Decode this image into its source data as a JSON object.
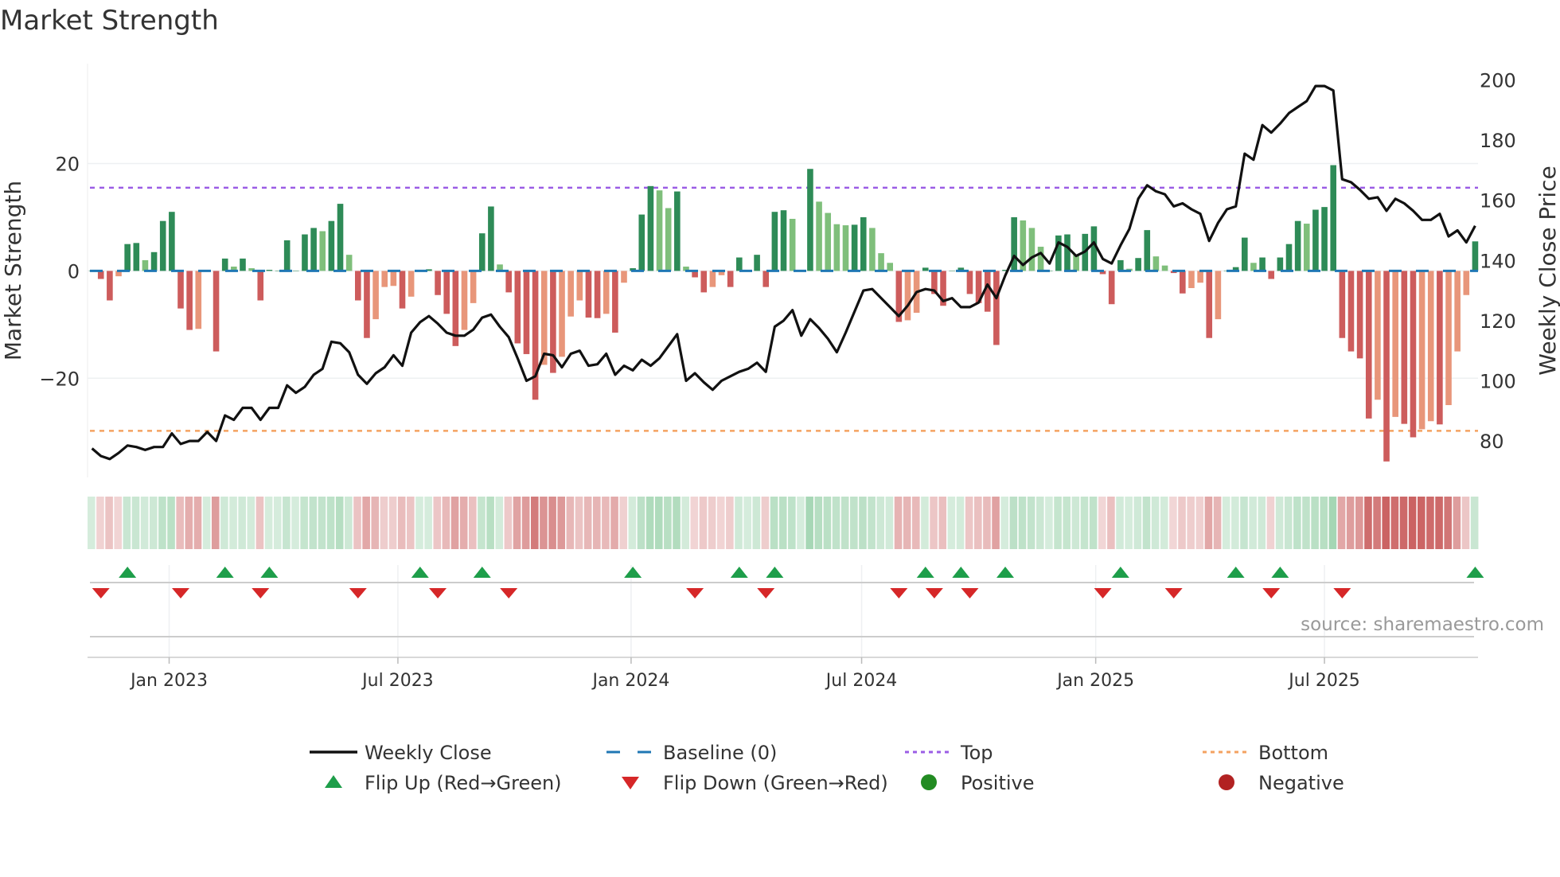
{
  "chart_data": {
    "type": "bar",
    "title": "Market Strength",
    "ylabel": "Market Strength",
    "y2label": "Weekly Close Price",
    "ylim": [
      -38,
      40
    ],
    "y2lim": [
      70,
      206
    ],
    "yticks": [
      20,
      0,
      -20
    ],
    "ytick_labels": [
      "20",
      "0",
      "−20"
    ],
    "y2ticks": [
      200,
      180,
      160,
      140,
      120,
      100,
      80
    ],
    "y2tick_labels": [
      "200",
      "180",
      "160",
      "140",
      "120",
      "100",
      "80"
    ],
    "top_level": 15.5,
    "bottom_level": -29.8,
    "baseline": 0,
    "xticks": [
      {
        "week": 8.7,
        "label": "Jan 2023"
      },
      {
        "week": 34.5,
        "label": "Jul 2023"
      },
      {
        "week": 60.8,
        "label": "Jan 2024"
      },
      {
        "week": 86.8,
        "label": "Jul 2024"
      },
      {
        "week": 113.2,
        "label": "Jan 2025"
      },
      {
        "week": 139.0,
        "label": "Jul 2025"
      }
    ],
    "strength": [
      0,
      -1.5,
      -5.5,
      -1,
      5,
      5.2,
      2,
      3.5,
      9.3,
      11,
      -7,
      -11,
      -10.8,
      0,
      -15,
      2.3,
      0.8,
      2.3,
      0.5,
      -5.5,
      0.2,
      0,
      5.7,
      0,
      6.8,
      8,
      7.4,
      9.3,
      12.5,
      3,
      -5.5,
      -12.5,
      -9,
      -3,
      -2.8,
      -7,
      -4.8,
      0,
      0.3,
      -4.5,
      -8,
      -14,
      -11,
      -6,
      7,
      12,
      1.2,
      -4,
      -13.5,
      -15.5,
      -24,
      -17.5,
      -19,
      -16,
      -8.5,
      -5.5,
      -8.7,
      -8.8,
      -8,
      -11.5,
      -2.2,
      0.5,
      10.5,
      15.8,
      15,
      11.7,
      14.8,
      0.8,
      -1.2,
      -4,
      -3,
      -0.8,
      -3,
      2.5,
      0.2,
      3,
      -3,
      11,
      11.3,
      9.7,
      0,
      19,
      12.9,
      10.8,
      8.7,
      8.5,
      8.6,
      10,
      8,
      3.3,
      1.5,
      -9.5,
      -9.2,
      -7.8,
      0.6,
      -4.3,
      -6.5,
      0,
      0.6,
      -4.3,
      -6,
      -7.6,
      -13.8,
      0.2,
      10,
      9.4,
      8,
      4.5,
      0,
      6.6,
      6.8,
      3,
      6.9,
      8.3,
      -0.6,
      -6.2,
      2,
      0.4,
      2.4,
      7.6,
      2.7,
      1,
      -0.4,
      -4.2,
      -3.2,
      -2.2,
      -12.5,
      -9,
      0,
      0.7,
      6.2,
      1.5,
      2.5,
      -1.5,
      2.5,
      5,
      9.3,
      8.8,
      11.4,
      11.9,
      19.7,
      -12.5,
      -15,
      -16.3,
      -27.5,
      -24,
      -35.5,
      -27.2,
      -28.5,
      -31,
      -29.5,
      -28,
      -28.6,
      -25,
      -15,
      -4.5,
      5.5
    ],
    "weekly_close": [
      77.5,
      75,
      74,
      76,
      78.5,
      78,
      77,
      78,
      78,
      82.5,
      79,
      80,
      80,
      83,
      80,
      88.5,
      87,
      91,
      91,
      87,
      91,
      91,
      98.5,
      96,
      98,
      102,
      104,
      113,
      112.5,
      109.5,
      102,
      99,
      102.5,
      104.5,
      108.5,
      105,
      116,
      119.5,
      121.5,
      119,
      116,
      115,
      115,
      117,
      121,
      122,
      118,
      114.5,
      107.5,
      100,
      101.5,
      109,
      108.5,
      104.5,
      109,
      110,
      105,
      105.5,
      109,
      102,
      105,
      103.5,
      107,
      105,
      107.5,
      111.5,
      115.5,
      100,
      102.5,
      99.5,
      97,
      100,
      101.5,
      103,
      104,
      106,
      103,
      118,
      120,
      123.5,
      115,
      120.5,
      117.5,
      114,
      109.5,
      116,
      123,
      130,
      130.5,
      127.5,
      124.5,
      121.5,
      125,
      129.5,
      130.5,
      130,
      126.5,
      127.5,
      124.5,
      124.5,
      126,
      132,
      127.5,
      135,
      141.5,
      138.5,
      141,
      142.5,
      139,
      146,
      144.5,
      141.5,
      143,
      146,
      140.5,
      139,
      145,
      150.5,
      160.5,
      165,
      163,
      162,
      158,
      159,
      157,
      155.5,
      146.5,
      152.5,
      157,
      158,
      175.5,
      173.5,
      185,
      182.5,
      185.5,
      189,
      191,
      193,
      198,
      198,
      196.5,
      167,
      166,
      163.5,
      160.5,
      161,
      156.5,
      160.5,
      159,
      156.5,
      153.5,
      153.5,
      155.5,
      148,
      150,
      146,
      151.5
    ],
    "flip_up_weeks": [
      4,
      15,
      20,
      37,
      44,
      61,
      73,
      77,
      94,
      98,
      103,
      116,
      129,
      134,
      156
    ],
    "flip_down_weeks": [
      1,
      10,
      19,
      30,
      39,
      47,
      68,
      76,
      91,
      95,
      99,
      114,
      122,
      133,
      141
    ],
    "legend": [
      {
        "label": "Weekly Close",
        "symbol": "line",
        "color": "#111111"
      },
      {
        "label": "Baseline (0)",
        "symbol": "dash",
        "color": "#1f77b4"
      },
      {
        "label": "Top",
        "symbol": "dot",
        "color": "#9b5de5"
      },
      {
        "label": "Bottom",
        "symbol": "dot",
        "color": "#f4a261"
      },
      {
        "label": "Flip Up (Red→Green)",
        "symbol": "triangle-up",
        "color": "#1e9e4a"
      },
      {
        "label": "Flip Down (Green→Red)",
        "symbol": "triangle-down",
        "color": "#d62728"
      },
      {
        "label": "Positive",
        "symbol": "circle",
        "color": "#228b22"
      },
      {
        "label": "Negative",
        "symbol": "circle",
        "color": "#b22222"
      }
    ],
    "legend_position": "bottom"
  },
  "colors": {
    "pos_strong": "#2e8b57",
    "pos_weak": "#7fbf7b",
    "neg_strong": "#cd5c5c",
    "neg_weak": "#e8967a"
  },
  "source": "source: sharemaestro.com"
}
